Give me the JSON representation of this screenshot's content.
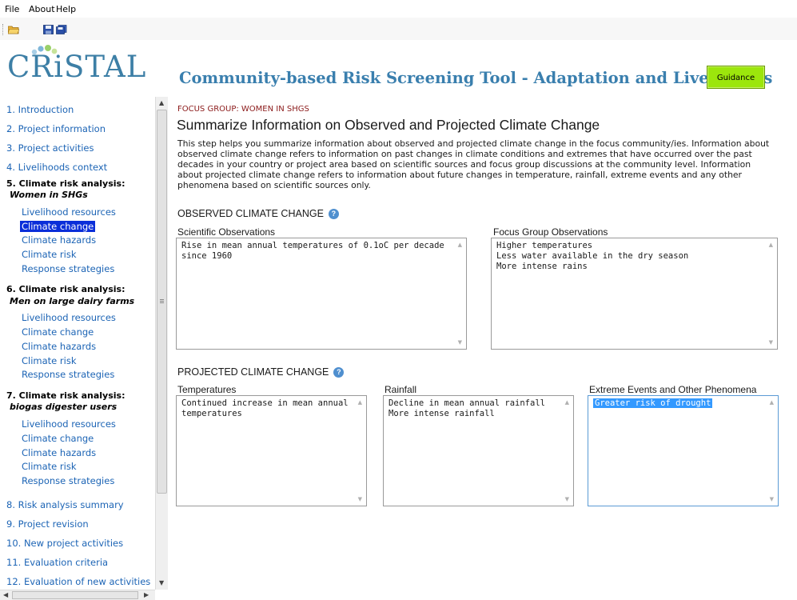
{
  "menu": {
    "file": "File",
    "about": "About",
    "help": "Help"
  },
  "toolbar": {
    "icons": [
      "open-folder-icon",
      "save-icon",
      "save-all-icon"
    ]
  },
  "logo": {
    "text": "CRiSTAL"
  },
  "banner": {
    "title": "Community-based Risk Screening Tool - Adaptation and Livelihoods",
    "guidance_label": "Guidance"
  },
  "sidebar": {
    "intro": "1. Introduction",
    "project_info": "2. Project information",
    "project_activities": "3. Project activities",
    "livelihoods_context": "4. Livelihoods context",
    "g5_title": "5. Climate risk analysis:",
    "g5_sub": "Women in SHGs",
    "g6_title": "6. Climate risk analysis:",
    "g6_sub": "Men on large dairy farms",
    "g7_title": "7. Climate risk analysis:",
    "g7_sub": "biogas digester users",
    "sub_items": [
      "Livelihood resources",
      "Climate change",
      "Climate hazards",
      "Climate risk",
      "Response strategies"
    ],
    "risk_summary": "8. Risk analysis summary",
    "project_revision": "9. Project revision",
    "new_activities": "10. New project activities",
    "evaluation_criteria": "11. Evaluation criteria",
    "evaluation_new": "12. Evaluation of new activities"
  },
  "main": {
    "focus_group": "FOCUS GROUP: WOMEN IN SHGS",
    "heading": "Summarize Information on Observed and Projected Climate Change",
    "intro": "This step helps you summarize information about observed and projected climate change in the focus community/ies. Information about observed climate change refers to information on past changes in climate conditions and extremes that have occurred over the past decades in your country or project area based on scientific sources and focus group discussions at the community level. Information about projected climate change refers to information about future changes in temperature, rainfall, extreme events and any other phenomena based on scientific sources only.",
    "observed_title": "OBSERVED CLIMATE CHANGE",
    "projected_title": "PROJECTED CLIMATE CHANGE",
    "scientific_label": "Scientific Observations",
    "scientific_lines": [
      "Rise in mean annual temperatures of 0.1oC per decade",
      "since 1960"
    ],
    "focus_obs_label": "Focus Group Observations",
    "focus_obs_lines": [
      "Higher temperatures",
      "Less water available in the dry season",
      "More intense rains"
    ],
    "temperatures_label": "Temperatures",
    "temperatures_lines": [
      "Continued increase in mean annual",
      "temperatures"
    ],
    "rainfall_label": "Rainfall",
    "rainfall_lines": [
      "Decline in mean annual rainfall",
      "More intense rainfall"
    ],
    "extreme_label": "Extreme Events and Other Phenomena",
    "extreme_lines": [
      "Greater risk of drought"
    ]
  },
  "colors": {
    "accent_blue": "#3a7fae",
    "link_blue": "#1c64b5",
    "selected": "#0a2ed9",
    "guidance_green": "#9ce60c",
    "focus_red": "#8b1a1a"
  }
}
